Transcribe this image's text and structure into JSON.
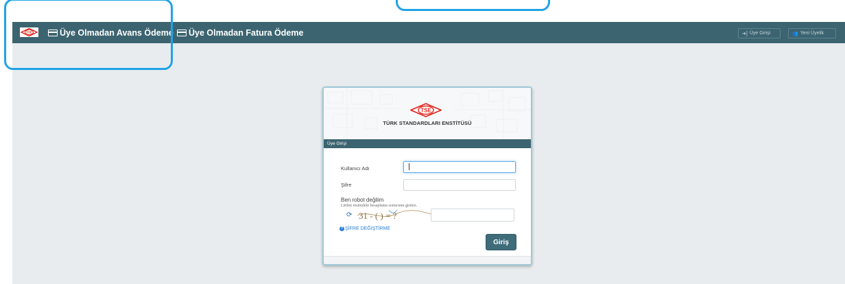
{
  "navbar": {
    "logo_text": "TSE",
    "links": [
      {
        "label": "Üye Olmadan Avans Ödeme",
        "icon": "credit-card-icon"
      },
      {
        "label": "Üye Olmadan Fatura Ödeme",
        "icon": "credit-card-icon"
      }
    ],
    "buttons": [
      {
        "label": "Üye Girişi",
        "icon": "sign-in-icon"
      },
      {
        "label": "Yeni Üyelik",
        "icon": "users-icon"
      }
    ]
  },
  "login": {
    "logo_text": "TSE",
    "org_name": "TÜRK STANDARDLARI ENSTİTÜSÜ",
    "section_title": "Üye Girişi",
    "username_label": "Kullanıcı Adı",
    "username_value": "",
    "password_label": "Şifre",
    "password_value": "",
    "robot_title": "Ben robot değilim",
    "robot_hint": "Lütfen resimdeki hesaplama sonucunu giriniz.",
    "captcha_text": "31 - ( ) = ?",
    "captcha_value": "",
    "password_change_link": "ŞİFRE DEĞİŞTİRME",
    "submit_label": "Giriş"
  },
  "colors": {
    "navbar": "#3c6470",
    "highlight": "#1fa3e6",
    "brand_red": "#e2231a",
    "link_blue": "#2a7fd4"
  }
}
